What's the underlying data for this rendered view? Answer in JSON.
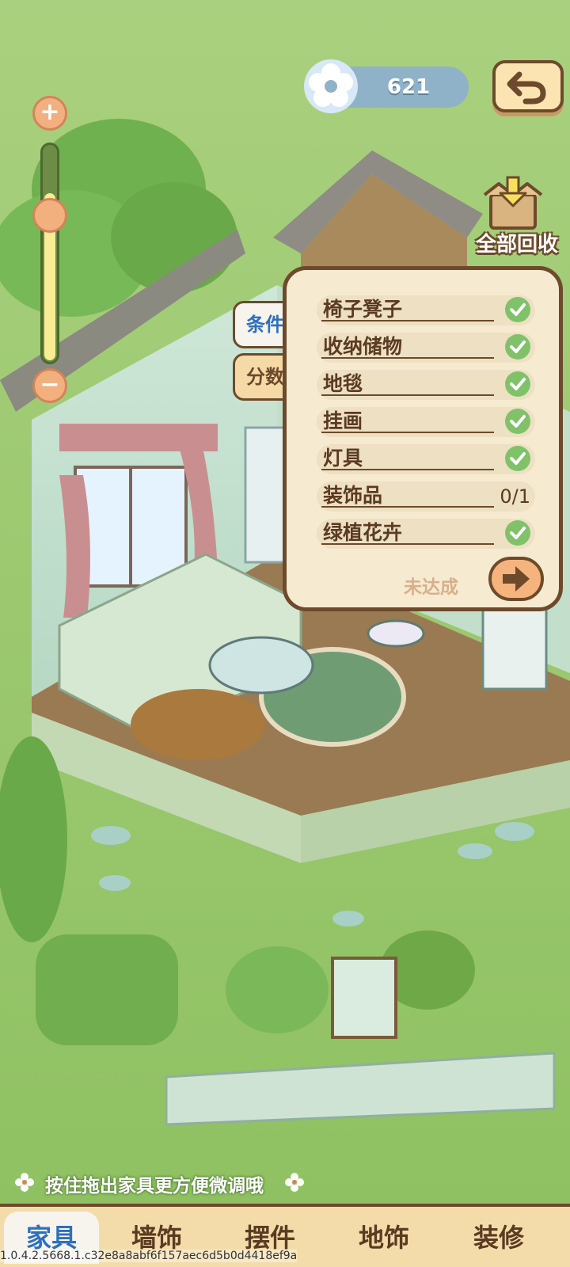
{
  "header": {
    "currency_value": "621",
    "currency_icon": "flower-icon",
    "back_icon": "undo-arrow-icon"
  },
  "zoom": {
    "plus_label": "+",
    "minus_label": "−",
    "level": 0.78
  },
  "recycle_all": {
    "label": "全部回收",
    "icon": "box-arrow-down-icon"
  },
  "side_tabs": [
    {
      "label": "条件",
      "active": true
    },
    {
      "label": "分数",
      "active": false
    }
  ],
  "conditions": [
    {
      "name": "椅子凳子",
      "done": true
    },
    {
      "name": "收纳储物",
      "done": true
    },
    {
      "name": "地毯",
      "done": true
    },
    {
      "name": "挂画",
      "done": true
    },
    {
      "name": "灯具",
      "done": true
    },
    {
      "name": "装饰品",
      "done": false,
      "progress": "0/1"
    },
    {
      "name": "绿植花卉",
      "done": true
    }
  ],
  "status_text": "未达成",
  "tip_text": "按住拖出家具更方便微调哦",
  "bottom_tabs": [
    {
      "label": "家具",
      "active": true
    },
    {
      "label": "墙饰",
      "active": false
    },
    {
      "label": "摆件",
      "active": false
    },
    {
      "label": "地饰",
      "active": false
    },
    {
      "label": "装修",
      "active": false
    }
  ],
  "version_text": "1.0.4.2.5668.1.c32e8a8abf6f157aec6d5b0d4418ef9a",
  "colors": {
    "grass": "#9fca76",
    "panel_bg": "#f6ead0",
    "border_brown": "#6d4a2b",
    "check_green": "#7fc26a",
    "active_blue": "#2d6fc2"
  }
}
